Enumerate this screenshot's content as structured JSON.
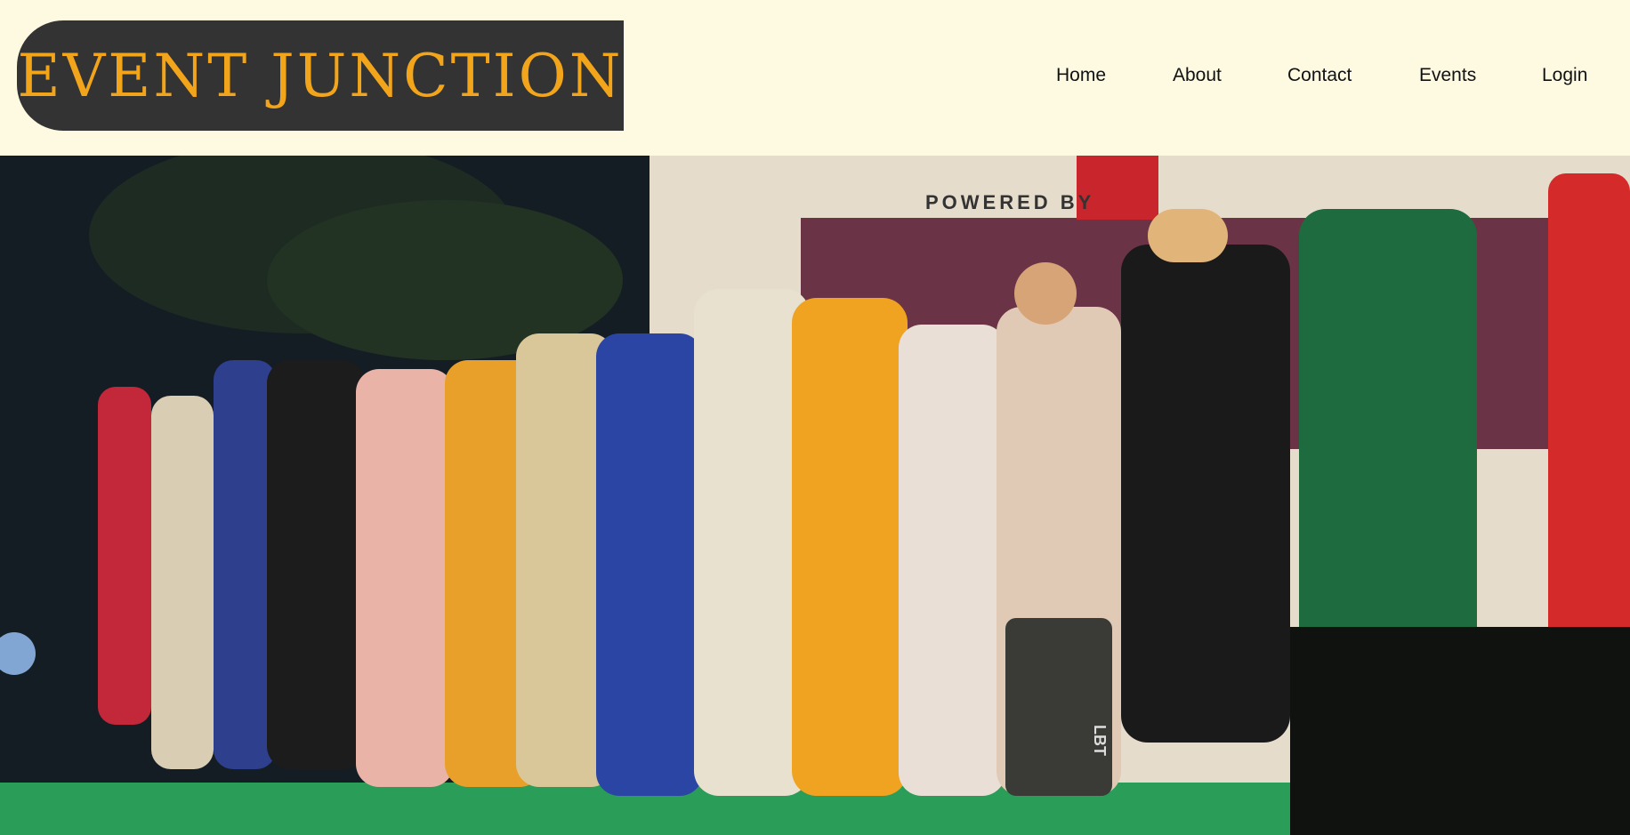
{
  "logo": {
    "text": "EVENT JUNCTION"
  },
  "nav": {
    "items": [
      {
        "label": "Home"
      },
      {
        "label": "About"
      },
      {
        "label": "Contact"
      },
      {
        "label": "Events"
      },
      {
        "label": "Login"
      }
    ]
  },
  "hero": {
    "banner_text": "POWERED BY",
    "speaker_label": "LBT"
  },
  "colors": {
    "page_background": "#fefae2",
    "logo_background": "#333333",
    "logo_text": "#f2a41b",
    "nav_text": "#111111"
  }
}
